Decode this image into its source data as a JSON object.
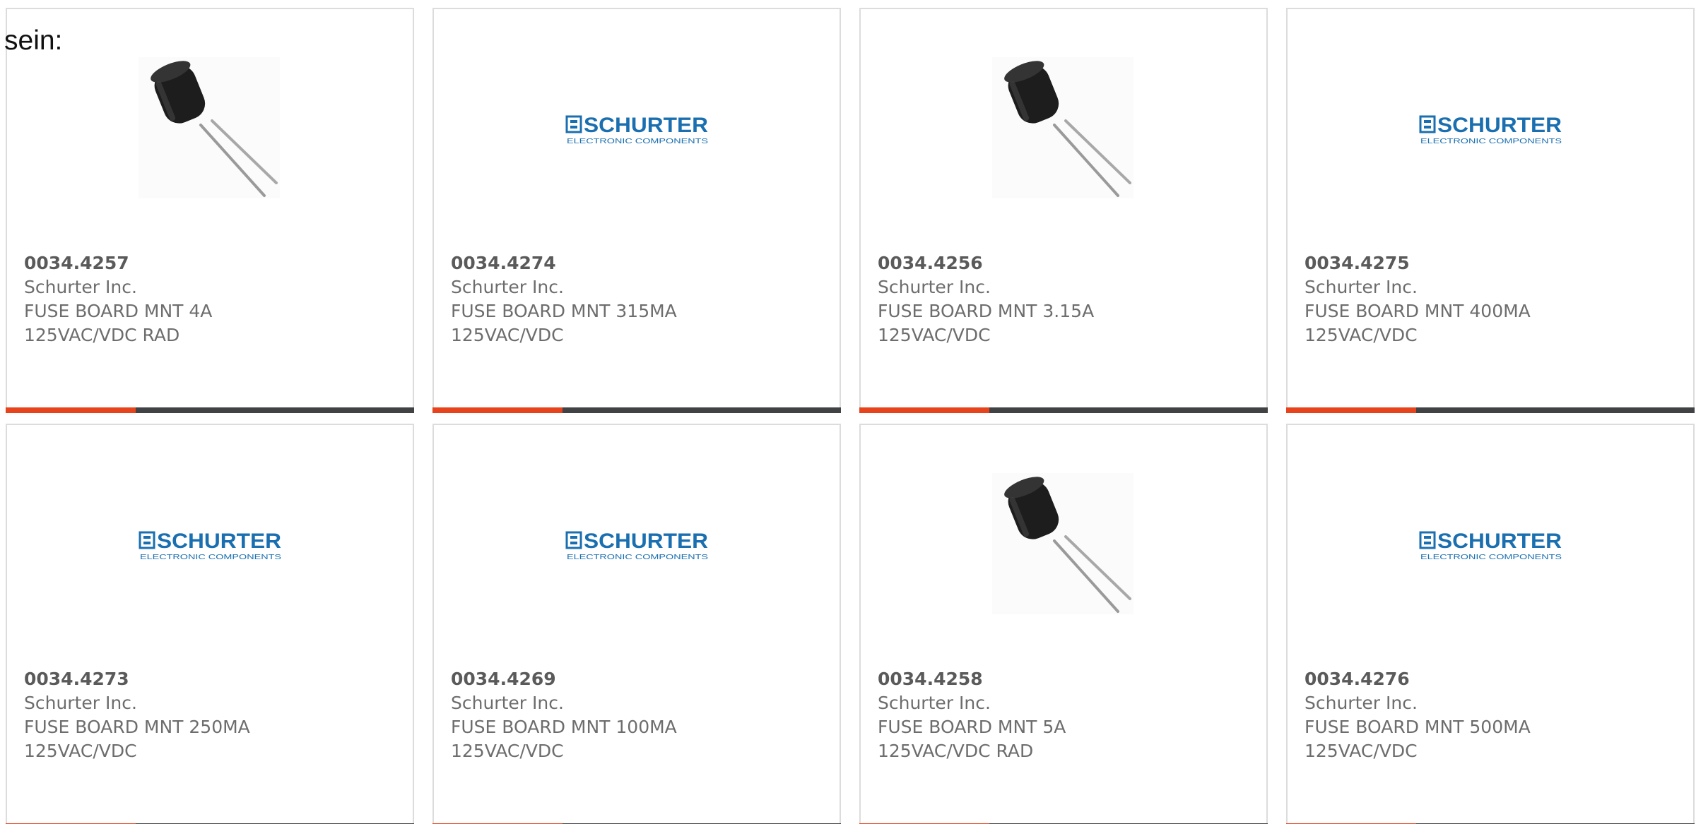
{
  "intro_text": "sein:",
  "brand": {
    "accent_color": "#e7441d",
    "bar_color": "#404244",
    "logo_color": "#1a6fb0",
    "logo_text": "SCHURTER",
    "logo_subtext": "ELECTRONIC COMPONENTS"
  },
  "products": [
    {
      "part_number": "0034.4257",
      "manufacturer": "Schurter Inc.",
      "description_line1": "FUSE BOARD MNT 4A",
      "description_line2": "125VAC/VDC RAD",
      "image": "capacitor-photo"
    },
    {
      "part_number": "0034.4274",
      "manufacturer": "Schurter Inc.",
      "description_line1": "FUSE BOARD MNT 315MA",
      "description_line2": "125VAC/VDC",
      "image": "schurter-logo"
    },
    {
      "part_number": "0034.4256",
      "manufacturer": "Schurter Inc.",
      "description_line1": "FUSE BOARD MNT 3.15A",
      "description_line2": "125VAC/VDC",
      "image": "capacitor-photo"
    },
    {
      "part_number": "0034.4275",
      "manufacturer": "Schurter Inc.",
      "description_line1": "FUSE BOARD MNT 400MA",
      "description_line2": "125VAC/VDC",
      "image": "schurter-logo"
    },
    {
      "part_number": "0034.4273",
      "manufacturer": "Schurter Inc.",
      "description_line1": "FUSE BOARD MNT 250MA",
      "description_line2": "125VAC/VDC",
      "image": "schurter-logo"
    },
    {
      "part_number": "0034.4269",
      "manufacturer": "Schurter Inc.",
      "description_line1": "FUSE BOARD MNT 100MA",
      "description_line2": "125VAC/VDC",
      "image": "schurter-logo"
    },
    {
      "part_number": "0034.4258",
      "manufacturer": "Schurter Inc.",
      "description_line1": "FUSE BOARD MNT 5A",
      "description_line2": "125VAC/VDC RAD",
      "image": "capacitor-photo"
    },
    {
      "part_number": "0034.4276",
      "manufacturer": "Schurter Inc.",
      "description_line1": "FUSE BOARD MNT 500MA",
      "description_line2": "125VAC/VDC",
      "image": "schurter-logo"
    }
  ]
}
